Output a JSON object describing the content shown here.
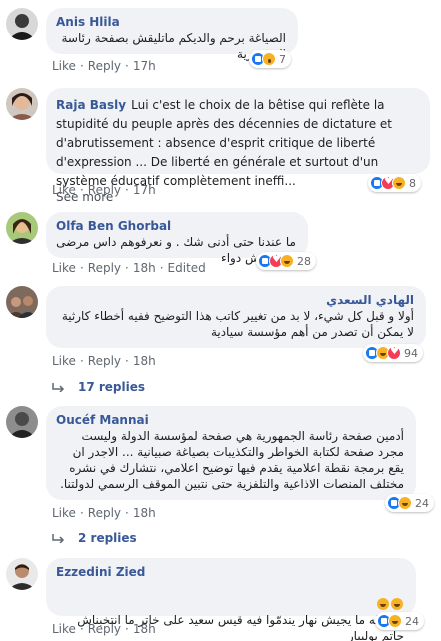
{
  "colors": {
    "author": "#385898",
    "bubble": "#f0f2f5",
    "like": "#1877f2",
    "love": "#f33e58",
    "haha": "#f7b125"
  },
  "actions": {
    "like": "Like",
    "reply": "Reply",
    "edited": "Edited",
    "separator": "·"
  },
  "comments": [
    {
      "author": "Anis Hlila",
      "text": "الصياغة برحم والديكم ماتليقش بصفحة رئاسة الجمهورية",
      "time": "17h",
      "reactions": [
        "like",
        "wow"
      ],
      "count": "7"
    },
    {
      "author": "Raja Basly",
      "text": "Lui c'est le choix de la bêtise qui reflète la stupidité du peuple après des décennies de dictature et d'abrutissement : absence d'esprit critique de liberté d'expression ... De liberté en générale et surtout d'un système éducatif complètement ineffi...",
      "see_more": "See more",
      "time": "17h",
      "reactions": [
        "like",
        "love",
        "haha"
      ],
      "count": "8"
    },
    {
      "author": "Olfa Ben Ghorbal",
      "text": "ما عندنا حتى أدنى شك . و نعرفوهم داس مرضى ما فيهمش دواء",
      "time": "18h",
      "edited": true,
      "reactions": [
        "like",
        "love",
        "haha"
      ],
      "count": "28"
    },
    {
      "author": "الهادي السعدي",
      "text": "أولا و قبل كل شيء، لا بد من تغيير كاتب هذا التوضيح ففيه أخطاء كارثية لا يمكن أن تصدر من أهم مؤسسة سيادية",
      "time": "18h",
      "reactions": [
        "like",
        "haha",
        "love"
      ],
      "count": "94",
      "replies": "17 replies"
    },
    {
      "author": "Oucéf Mannai",
      "text": "أدمين صفحة رئاسة الجمهورية هي صفحة لمؤسسة الدولة وليست مجرد صفحة لكتابة الخواطر والتكذيبات بصياغة صبيانية ... الاجدر ان يقع برمجة نقطة اعلامية يقدم فيها توضيح اعلامي، نتشارك في نشره مختلف المنصات الاذاعية والتلفزية حتى نتبين الموقف الرسمي لدولتنا.",
      "time": "18h",
      "reactions": [
        "like",
        "haha"
      ],
      "count": "24",
      "replies": "2 replies"
    },
    {
      "author": "Ezzedini Zied",
      "text": "إنشالله ما يجيش نهار يندمّوا فيه قيس سعيد على خاتر ما انتخبناش حاتم بولبيار",
      "time": "18h",
      "reactions": [
        "like",
        "haha"
      ],
      "count": "24"
    }
  ]
}
